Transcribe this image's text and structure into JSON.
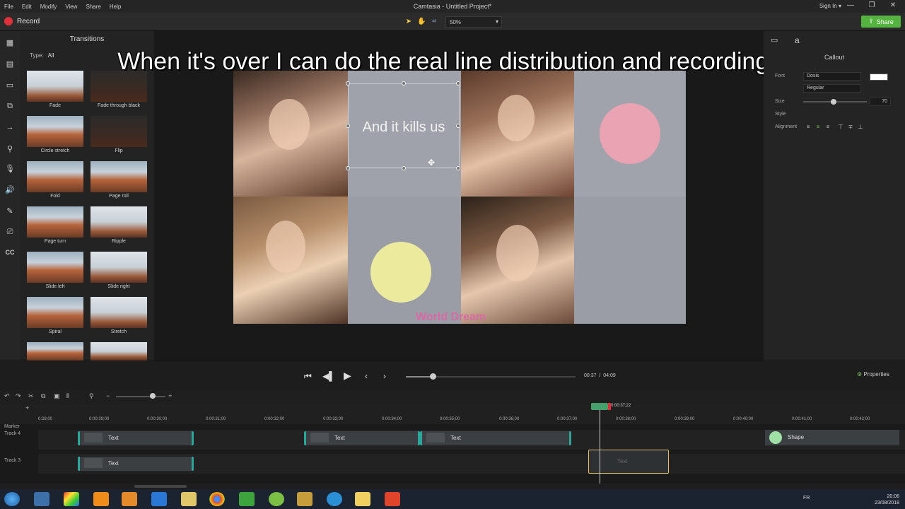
{
  "window": {
    "title": "Camtasia - Untitled Project*",
    "menu": [
      "File",
      "Edit",
      "Modify",
      "View",
      "Share",
      "Help"
    ],
    "signin": "Sign In ▾",
    "controls": [
      "—",
      "❐",
      "✕"
    ]
  },
  "toolbar": {
    "record_label": "Record",
    "zoom": "50%",
    "share_label": "Share"
  },
  "transitions": {
    "title": "Transitions",
    "type_label": "Type:",
    "type_value": "All",
    "items": [
      {
        "label": "Fade"
      },
      {
        "label": "Fade through black"
      },
      {
        "label": "Circle stretch"
      },
      {
        "label": "Flip"
      },
      {
        "label": "Fold"
      },
      {
        "label": "Page roll"
      },
      {
        "label": "Page turn"
      },
      {
        "label": "Ripple"
      },
      {
        "label": "Slide left"
      },
      {
        "label": "Slide right"
      },
      {
        "label": "Spiral"
      },
      {
        "label": "Stretch"
      }
    ]
  },
  "canvas": {
    "overlay_caption": "When it's over I can do the real line distribution and recording it",
    "selected_text": "And it kills us",
    "footer_text": "World Dream",
    "colors": {
      "pink_circle": "#e9a3b3",
      "yellow_circle": "#ecea9c",
      "footer_text": "#d96aa5"
    }
  },
  "properties": {
    "title": "Callout",
    "font_label": "Font",
    "font_value": "Dosis",
    "weight_value": "Regular",
    "size_label": "Size",
    "size_value": "70",
    "style_label": "Style",
    "alignment_label": "Alignment"
  },
  "playback": {
    "current": "00:37",
    "separator": "/",
    "total": "04:09",
    "properties_label": "Properties"
  },
  "timeline": {
    "playhead_time": "0:00:37;22",
    "ruler": [
      "0:28;00",
      "0:00:29;00",
      "0:00:30;00",
      "0:00:31;00",
      "0:00:32;00",
      "0:00:33;00",
      "0:00:34;00",
      "0:00:35;00",
      "0:00:36;00",
      "0:00:37;00",
      "0:00:38;00",
      "0:00:39;00",
      "0:00:40;00",
      "0:00:41;00",
      "0:00:42;00"
    ],
    "marker_label": "Marker",
    "tracks": [
      {
        "name": "Track 4",
        "clips": [
          "Text",
          "Text",
          "Text"
        ],
        "shape": "Shape"
      },
      {
        "name": "Track 3",
        "clips": [
          "Text",
          "Text"
        ]
      }
    ]
  },
  "taskbar": {
    "lang": "FR",
    "time": "20:06",
    "date": "23/08/2018"
  }
}
